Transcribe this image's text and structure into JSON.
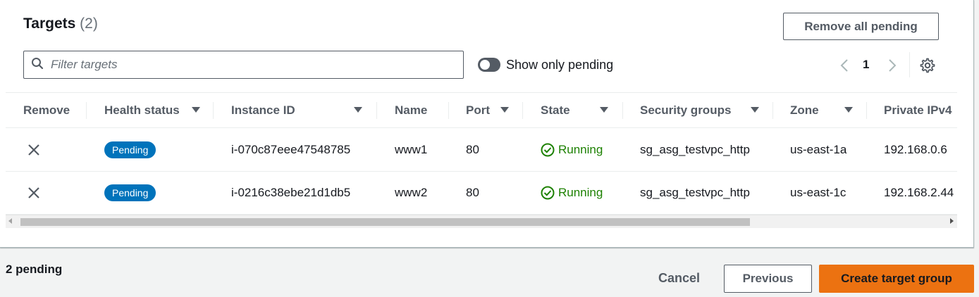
{
  "targets": {
    "title": "Targets",
    "count": "(2)",
    "remove_all_label": "Remove all pending",
    "filter_placeholder": "Filter targets",
    "show_only_pending_label": "Show only pending",
    "page": "1",
    "columns": [
      "Remove",
      "Health status",
      "Instance ID",
      "Name",
      "Port",
      "State",
      "Security groups",
      "Zone",
      "Private IPv4"
    ],
    "rows": [
      {
        "health": "Pending",
        "instance_id": "i-070c87eee47548785",
        "name": "www1",
        "port": "80",
        "state": "Running",
        "security_group": "sg_asg_testvpc_http",
        "zone": "us-east-1a",
        "ipv4": "192.168.0.6"
      },
      {
        "health": "Pending",
        "instance_id": "i-0216c38ebe21d1db5",
        "name": "www2",
        "port": "80",
        "state": "Running",
        "security_group": "sg_asg_testvpc_http",
        "zone": "us-east-1c",
        "ipv4": "192.168.2.44"
      }
    ]
  },
  "footer": {
    "pending_count": "2 pending",
    "cancel_label": "Cancel",
    "previous_label": "Previous",
    "create_label": "Create target group"
  },
  "colors": {
    "accent": "#ec7211",
    "badge": "#0073bb",
    "running": "#1d8102"
  }
}
